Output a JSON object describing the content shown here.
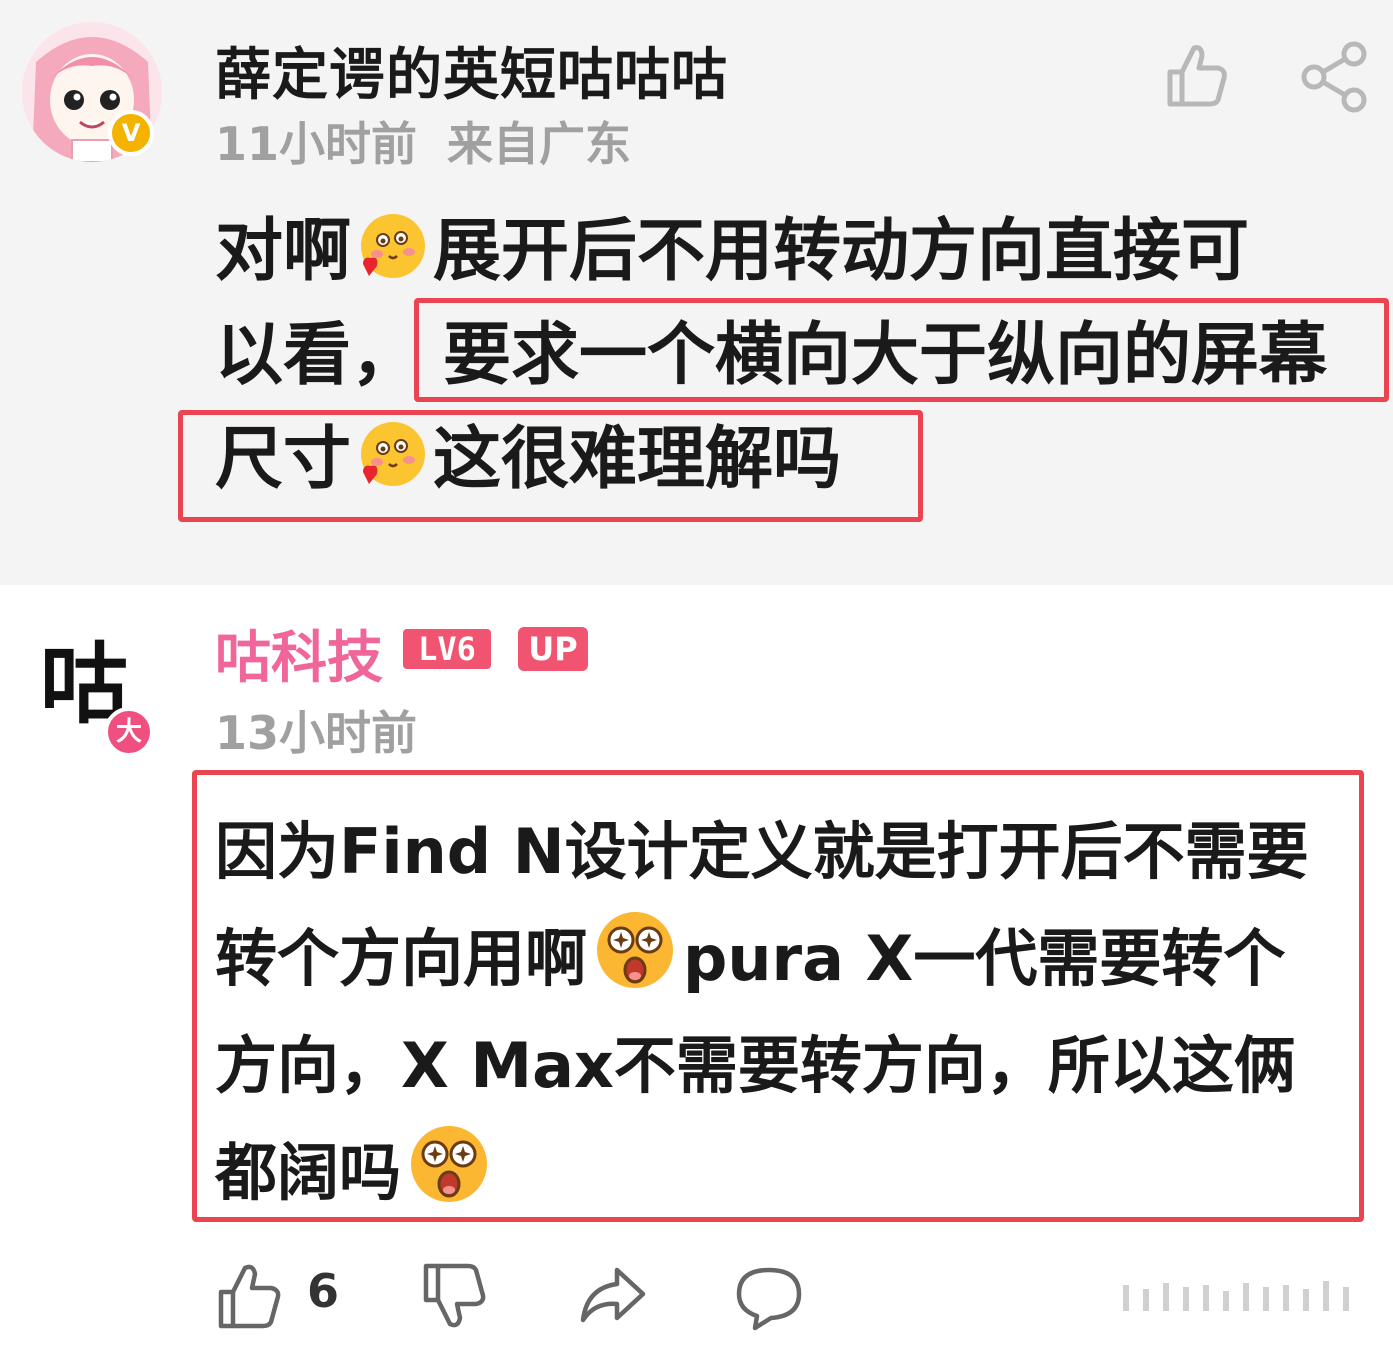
{
  "top_comment": {
    "user_name": "薛定谔的英短咕咕咕",
    "verified_badge": "V",
    "time": "11小时前",
    "location": "来自广东",
    "lines": [
      {
        "before": "对啊",
        "emoji": "love-emoji",
        "after": "展开后不用转动方向直接可"
      },
      {
        "before": "以看，",
        "after": "要求一个横向大于纵向的屏幕"
      },
      {
        "before": "尺寸",
        "emoji": "love-emoji",
        "after": "这很难理解吗"
      }
    ],
    "icons": [
      "thumbs-up-icon",
      "share-icon"
    ]
  },
  "bottom_comment": {
    "avatar_char": "咕",
    "avatar_badge": "大",
    "user_name": "咕科技",
    "level_badge": "LV6",
    "up_badge": "UP",
    "time": "13小时前",
    "lines": [
      {
        "text": "因为Find N设计定义就是打开后不需要"
      },
      {
        "before": "转个方向用啊",
        "emoji": "star-eyes-emoji",
        "after": "pura X一代需要转个"
      },
      {
        "text": "方向，X Max不需要转方向，所以这俩"
      },
      {
        "before": "都阔吗",
        "emoji": "star-eyes-emoji",
        "after": ""
      }
    ],
    "actions": {
      "like_count": "6",
      "icons": [
        "thumbs-up-icon",
        "thumbs-down-icon",
        "forward-icon",
        "comment-icon"
      ]
    }
  },
  "colors": {
    "highlight_border": "#e9444f",
    "up_name": "#f0669a",
    "badge_pink": "#f05470",
    "meta_gray": "#a0a0a0",
    "verified_gold": "#f5b301"
  }
}
